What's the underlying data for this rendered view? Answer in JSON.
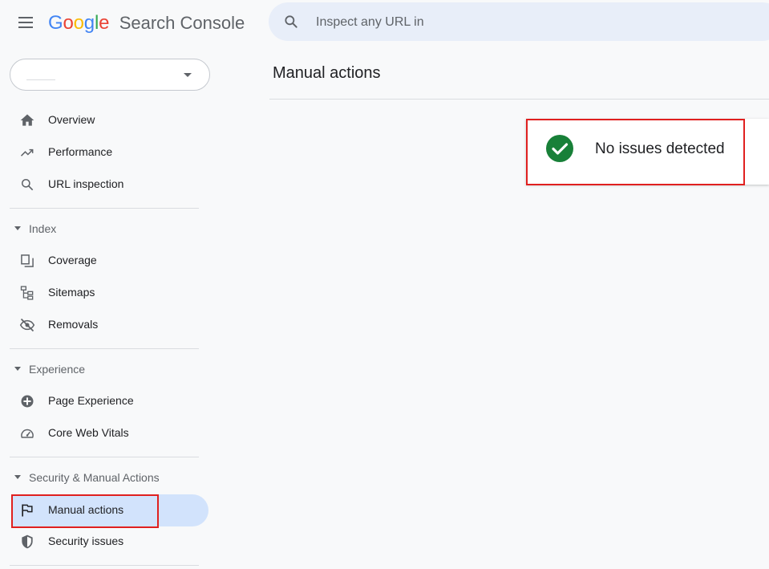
{
  "header": {
    "logo_letters": [
      {
        "ch": "G",
        "color": "#4285F4"
      },
      {
        "ch": "o",
        "color": "#EA4335"
      },
      {
        "ch": "o",
        "color": "#FBBC05"
      },
      {
        "ch": "g",
        "color": "#4285F4"
      },
      {
        "ch": "l",
        "color": "#34A853"
      },
      {
        "ch": "e",
        "color": "#EA4335"
      }
    ],
    "product_name": "Search Console",
    "search_placeholder": "Inspect any URL in",
    "menu_icon": "hamburger-menu-icon",
    "search_icon": "search-icon"
  },
  "property_selector": {
    "value": "",
    "icon": "dropdown-caret-icon"
  },
  "sidebar": {
    "items_top": [
      {
        "label": "Overview",
        "icon": "home-icon"
      },
      {
        "label": "Performance",
        "icon": "trending-up-icon"
      },
      {
        "label": "URL inspection",
        "icon": "search-icon"
      }
    ],
    "sections": [
      {
        "label": "Index",
        "items": [
          {
            "label": "Coverage",
            "icon": "file-copy-icon"
          },
          {
            "label": "Sitemaps",
            "icon": "sitemap-icon"
          },
          {
            "label": "Removals",
            "icon": "visibility-off-icon"
          }
        ]
      },
      {
        "label": "Experience",
        "items": [
          {
            "label": "Page Experience",
            "icon": "page-experience-icon"
          },
          {
            "label": "Core Web Vitals",
            "icon": "speedometer-icon"
          }
        ]
      },
      {
        "label": "Security & Manual Actions",
        "items": [
          {
            "label": "Manual actions",
            "icon": "flag-icon",
            "active": true
          },
          {
            "label": "Security issues",
            "icon": "shield-icon"
          }
        ]
      }
    ]
  },
  "main": {
    "title": "Manual actions",
    "status_text": "No issues detected",
    "status_icon": "check-circle-icon",
    "status_color": "#188038"
  },
  "colors": {
    "active_nav": "#d2e3fc",
    "highlight_box": "#e0201f",
    "search_bg": "#e8eef9"
  }
}
